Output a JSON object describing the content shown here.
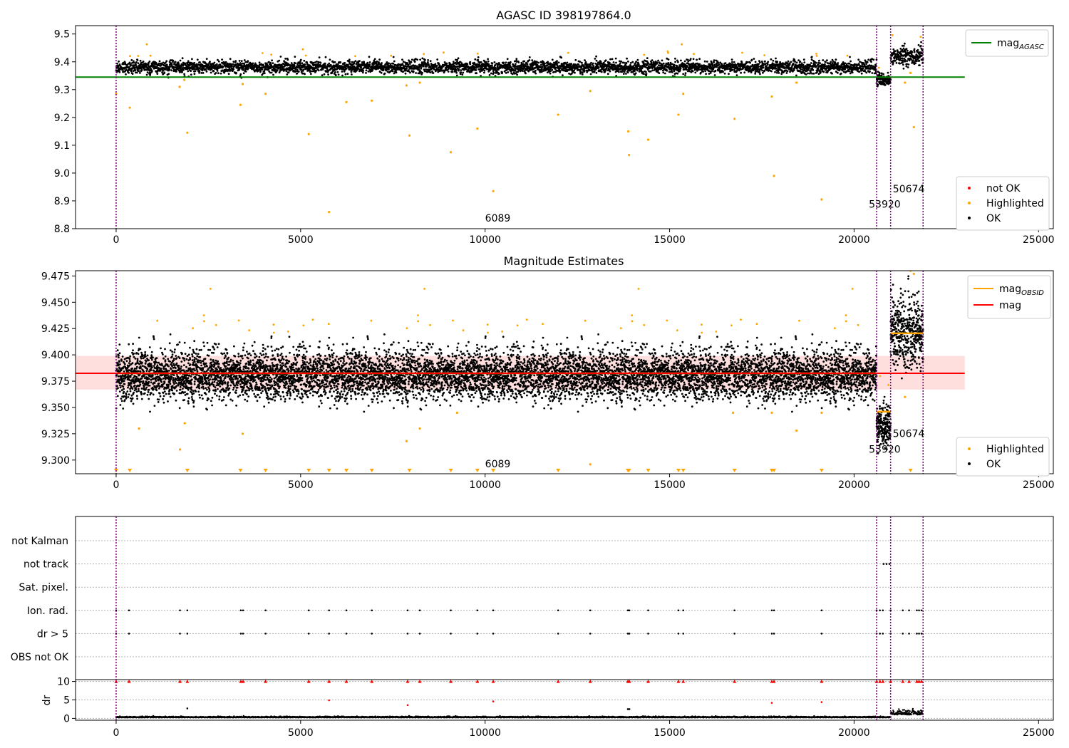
{
  "colors": {
    "ok": "#000000",
    "highlighted": "#ffa500",
    "not_ok": "#ff0000",
    "mag_agasc": "#008000",
    "mag": "#ff0000",
    "mag_obsid": "#ffa500",
    "band": "#ffd6d6",
    "obs_line": "#800080",
    "grid": "#b0b0b0"
  },
  "chart_data": [
    {
      "type": "scatter",
      "title": "AGASC ID 398197864.0",
      "xlim": [
        -1100,
        25400
      ],
      "ylim": [
        8.8,
        9.53
      ],
      "xticks": [
        0,
        5000,
        10000,
        15000,
        20000,
        25000
      ],
      "yticks": [
        8.8,
        8.9,
        9.0,
        9.1,
        9.2,
        9.3,
        9.4,
        9.5
      ],
      "legend_lines": [
        {
          "name": "mag",
          "sub": "AGASC",
          "color": "#008000"
        }
      ],
      "legend_points": [
        {
          "name": "not OK",
          "color": "#ff0000"
        },
        {
          "name": "Highlighted",
          "color": "#ffa500"
        },
        {
          "name": "OK",
          "color": "#000000"
        }
      ],
      "hline": {
        "y": 9.345,
        "x": [
          -1100,
          23000
        ],
        "color": "#008000"
      },
      "obs_boundaries": [
        0,
        20610,
        20990,
        21870
      ],
      "annotations": [
        {
          "text": "6089",
          "x": 10000,
          "y": 8.825
        },
        {
          "text": "53920",
          "x": 20400,
          "y": 8.875
        },
        {
          "text": "50674",
          "x": 21050,
          "y": 8.93
        }
      ],
      "segments": [
        {
          "x": [
            0,
            20610
          ],
          "mean": 9.38,
          "spread": 0.011
        },
        {
          "x": [
            20610,
            20990
          ],
          "mean": 9.335,
          "spread": 0.01
        },
        {
          "x": [
            20990,
            21870
          ],
          "mean": 9.418,
          "spread": 0.016
        }
      ],
      "highlighted": [
        [
          0,
          9.285
        ],
        [
          370,
          9.235
        ],
        [
          1720,
          9.31
        ],
        [
          1850,
          9.335
        ],
        [
          1930,
          9.145
        ],
        [
          3370,
          9.245
        ],
        [
          3430,
          9.32
        ],
        [
          4050,
          9.285
        ],
        [
          5220,
          9.14
        ],
        [
          5770,
          8.86
        ],
        [
          6240,
          9.255
        ],
        [
          6930,
          9.26
        ],
        [
          7870,
          9.315
        ],
        [
          7950,
          9.135
        ],
        [
          8230,
          9.325
        ],
        [
          9070,
          9.075
        ],
        [
          9790,
          9.16
        ],
        [
          10220,
          8.935
        ],
        [
          11980,
          9.21
        ],
        [
          12850,
          9.295
        ],
        [
          13880,
          9.15
        ],
        [
          13900,
          9.065
        ],
        [
          14420,
          9.12
        ],
        [
          15240,
          9.21
        ],
        [
          15370,
          9.285
        ],
        [
          16760,
          9.195
        ],
        [
          17770,
          9.275
        ],
        [
          17830,
          8.99
        ],
        [
          18440,
          9.325
        ],
        [
          19120,
          8.905
        ],
        [
          21380,
          9.325
        ],
        [
          21530,
          9.36
        ],
        [
          21620,
          9.165
        ]
      ]
    },
    {
      "type": "scatter",
      "title": "Magnitude Estimates",
      "xlim": [
        -1100,
        25400
      ],
      "ylim": [
        9.287,
        9.48
      ],
      "xticks": [
        0,
        5000,
        10000,
        15000,
        20000,
        25000
      ],
      "yticks": [
        9.3,
        9.325,
        9.35,
        9.375,
        9.4,
        9.425,
        9.45,
        9.475
      ],
      "legend_lines": [
        {
          "name": "mag",
          "sub": "OBSID",
          "color": "#ffa500"
        },
        {
          "name": "mag",
          "sub": "",
          "color": "#ff0000"
        }
      ],
      "legend_points": [
        {
          "name": "Highlighted",
          "color": "#ffa500"
        },
        {
          "name": "OK",
          "color": "#000000"
        }
      ],
      "hline": {
        "y": 9.3825,
        "x": [
          -1100,
          23000
        ],
        "color": "#ff0000"
      },
      "band": {
        "y": [
          9.367,
          9.399
        ],
        "x": [
          -1100,
          23000
        ]
      },
      "obsid_means": [
        {
          "x": [
            0,
            20610
          ],
          "y": 9.3825
        },
        {
          "x": [
            20610,
            20990
          ],
          "y": 9.346
        },
        {
          "x": [
            20990,
            21870
          ],
          "y": 9.4205
        }
      ],
      "obs_boundaries": [
        0,
        20610,
        20990,
        21870
      ],
      "annotations": [
        {
          "text": "6089",
          "x": 10000,
          "y": 9.293
        },
        {
          "text": "53920",
          "x": 20400,
          "y": 9.307
        },
        {
          "text": "50674",
          "x": 21050,
          "y": 9.322
        }
      ],
      "segments": [
        {
          "x": [
            0,
            20610
          ],
          "mean": 9.38,
          "spread": 0.011
        },
        {
          "x": [
            20610,
            20990
          ],
          "mean": 9.332,
          "spread": 0.01
        },
        {
          "x": [
            20990,
            21870
          ],
          "mean": 9.42,
          "spread": 0.016
        }
      ],
      "highlighted": [
        [
          620,
          9.33
        ],
        [
          1730,
          9.31
        ],
        [
          1860,
          9.335
        ],
        [
          3430,
          9.325
        ],
        [
          8230,
          9.33
        ],
        [
          7870,
          9.318
        ],
        [
          9240,
          9.345
        ],
        [
          12850,
          9.296
        ],
        [
          16720,
          9.345
        ],
        [
          17770,
          9.345
        ],
        [
          18440,
          9.328
        ],
        [
          19120,
          9.345
        ],
        [
          21380,
          9.36
        ],
        [
          21620,
          9.477
        ]
      ],
      "clipped_low": [
        0,
        370,
        1930,
        3370,
        4050,
        5220,
        5770,
        6240,
        6930,
        7950,
        9070,
        9790,
        10220,
        11980,
        13870,
        13900,
        14420,
        15240,
        15370,
        16760,
        17770,
        17830,
        19120,
        21530
      ]
    },
    {
      "type": "scatter",
      "title": "",
      "xlim": [
        -1100,
        25400
      ],
      "xticks": [
        0,
        5000,
        10000,
        15000,
        20000,
        25000
      ],
      "flag_rows": [
        "not Kalman",
        "not track",
        "Sat. pixel.",
        "Ion. rad.",
        "dr > 5",
        "OBS not OK"
      ],
      "dr_ylabel": "dr",
      "dr_yticks": [
        0,
        5,
        10
      ],
      "dr_ylim": [
        -0.5,
        10.5
      ],
      "obs_boundaries": [
        0,
        20610,
        20990,
        21870
      ],
      "flagged_times": [
        0,
        350,
        1730,
        1930,
        3380,
        3440,
        4050,
        5220,
        5770,
        6240,
        6930,
        7900,
        8230,
        9070,
        9790,
        10220,
        11980,
        12850,
        13870,
        13910,
        14420,
        15240,
        15370,
        16760,
        17770,
        17830,
        19120,
        20610,
        20700,
        20780,
        20990,
        21320,
        21490,
        21700,
        21760,
        21830
      ],
      "not_track_times": [
        20800,
        20880,
        20960
      ],
      "dr_outliers": [
        [
          1930,
          2.7
        ],
        [
          5770,
          4.9
        ],
        [
          7900,
          3.6
        ],
        [
          10220,
          4.6
        ],
        [
          13870,
          2.5
        ],
        [
          13910,
          2.5
        ],
        [
          17770,
          4.2
        ],
        [
          19120,
          4.4
        ]
      ]
    }
  ]
}
